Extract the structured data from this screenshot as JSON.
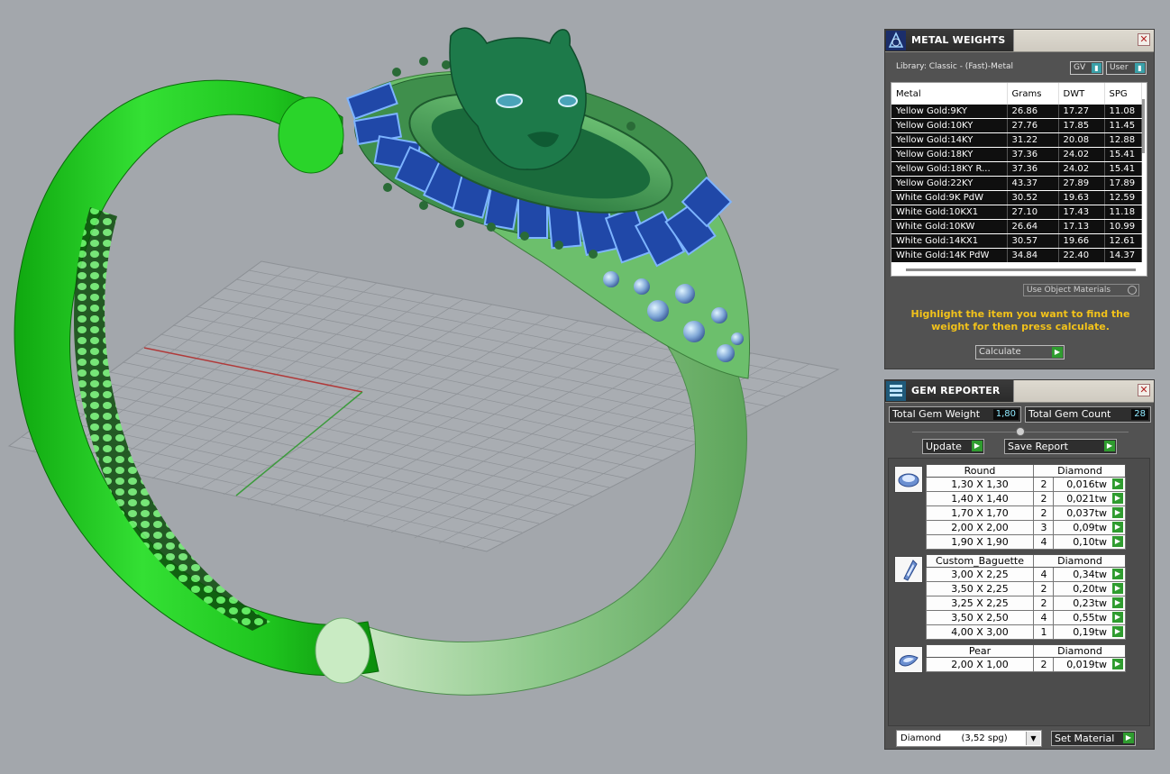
{
  "colors": {
    "viewport_bg": "#a3a7ac",
    "panel_bg": "#525252",
    "hint_text": "#f2c21a",
    "accent_green": "#2f9c2f",
    "value_cyan": "#8fe9ff"
  },
  "metal_weights": {
    "title": "METAL WEIGHTS",
    "close_icon": "close-icon",
    "library_label": "Library: Classic - (Fast)-Metal",
    "gv_label": "GV",
    "user_label": "User",
    "columns": [
      "Metal",
      "Grams",
      "DWT",
      "SPG"
    ],
    "rows": [
      {
        "metal": "Yellow Gold:9KY",
        "grams": "26.86",
        "dwt": "17.27",
        "spg": "11.08"
      },
      {
        "metal": "Yellow Gold:10KY",
        "grams": "27.76",
        "dwt": "17.85",
        "spg": "11.45"
      },
      {
        "metal": "Yellow Gold:14KY",
        "grams": "31.22",
        "dwt": "20.08",
        "spg": "12.88"
      },
      {
        "metal": "Yellow Gold:18KY",
        "grams": "37.36",
        "dwt": "24.02",
        "spg": "15.41"
      },
      {
        "metal": "Yellow Gold:18KY R...",
        "grams": "37.36",
        "dwt": "24.02",
        "spg": "15.41"
      },
      {
        "metal": "Yellow Gold:22KY",
        "grams": "43.37",
        "dwt": "27.89",
        "spg": "17.89"
      },
      {
        "metal": "White Gold:9K PdW",
        "grams": "30.52",
        "dwt": "19.63",
        "spg": "12.59"
      },
      {
        "metal": "White Gold:10KX1",
        "grams": "27.10",
        "dwt": "17.43",
        "spg": "11.18"
      },
      {
        "metal": "White Gold:10KW",
        "grams": "26.64",
        "dwt": "17.13",
        "spg": "10.99"
      },
      {
        "metal": "White Gold:14KX1",
        "grams": "30.57",
        "dwt": "19.66",
        "spg": "12.61"
      },
      {
        "metal": "White Gold:14K PdW",
        "grams": "34.84",
        "dwt": "22.40",
        "spg": "14.37"
      }
    ],
    "use_object_materials_label": "Use Object Materials",
    "hint": "Highlight the item you want to find the weight for then press calculate.",
    "calculate_label": "Calculate"
  },
  "gem_reporter": {
    "title": "GEM REPORTER",
    "total_weight_label": "Total Gem Weight",
    "total_weight_value": "1,80",
    "total_count_label": "Total Gem Count",
    "total_count_value": "28",
    "update_label": "Update",
    "save_report_label": "Save Report",
    "groups": [
      {
        "shape": "Round",
        "material": "Diamond",
        "icon": "round-gem-icon",
        "rows": [
          {
            "size": "1,30 X 1,30",
            "count": "2",
            "tw": "0,016tw"
          },
          {
            "size": "1,40 X 1,40",
            "count": "2",
            "tw": "0,021tw"
          },
          {
            "size": "1,70 X 1,70",
            "count": "2",
            "tw": "0,037tw"
          },
          {
            "size": "2,00 X 2,00",
            "count": "3",
            "tw": "0,09tw"
          },
          {
            "size": "1,90 X 1,90",
            "count": "4",
            "tw": "0,10tw"
          }
        ]
      },
      {
        "shape": "Custom_Baguette",
        "material": "Diamond",
        "icon": "baguette-gem-icon",
        "rows": [
          {
            "size": "3,00 X 2,25",
            "count": "4",
            "tw": "0,34tw"
          },
          {
            "size": "3,50 X 2,25",
            "count": "2",
            "tw": "0,20tw"
          },
          {
            "size": "3,25 X 2,25",
            "count": "2",
            "tw": "0,23tw"
          },
          {
            "size": "3,50 X 2,50",
            "count": "4",
            "tw": "0,55tw"
          },
          {
            "size": "4,00 X 3,00",
            "count": "1",
            "tw": "0,19tw"
          }
        ]
      },
      {
        "shape": "Pear",
        "material": "Diamond",
        "icon": "pear-gem-icon",
        "rows": [
          {
            "size": "2,00 X 1,00",
            "count": "2",
            "tw": "0,019tw"
          }
        ]
      }
    ],
    "material_select_name": "Diamond",
    "material_select_spg": "(3,52 spg)",
    "set_material_label": "Set Material"
  }
}
